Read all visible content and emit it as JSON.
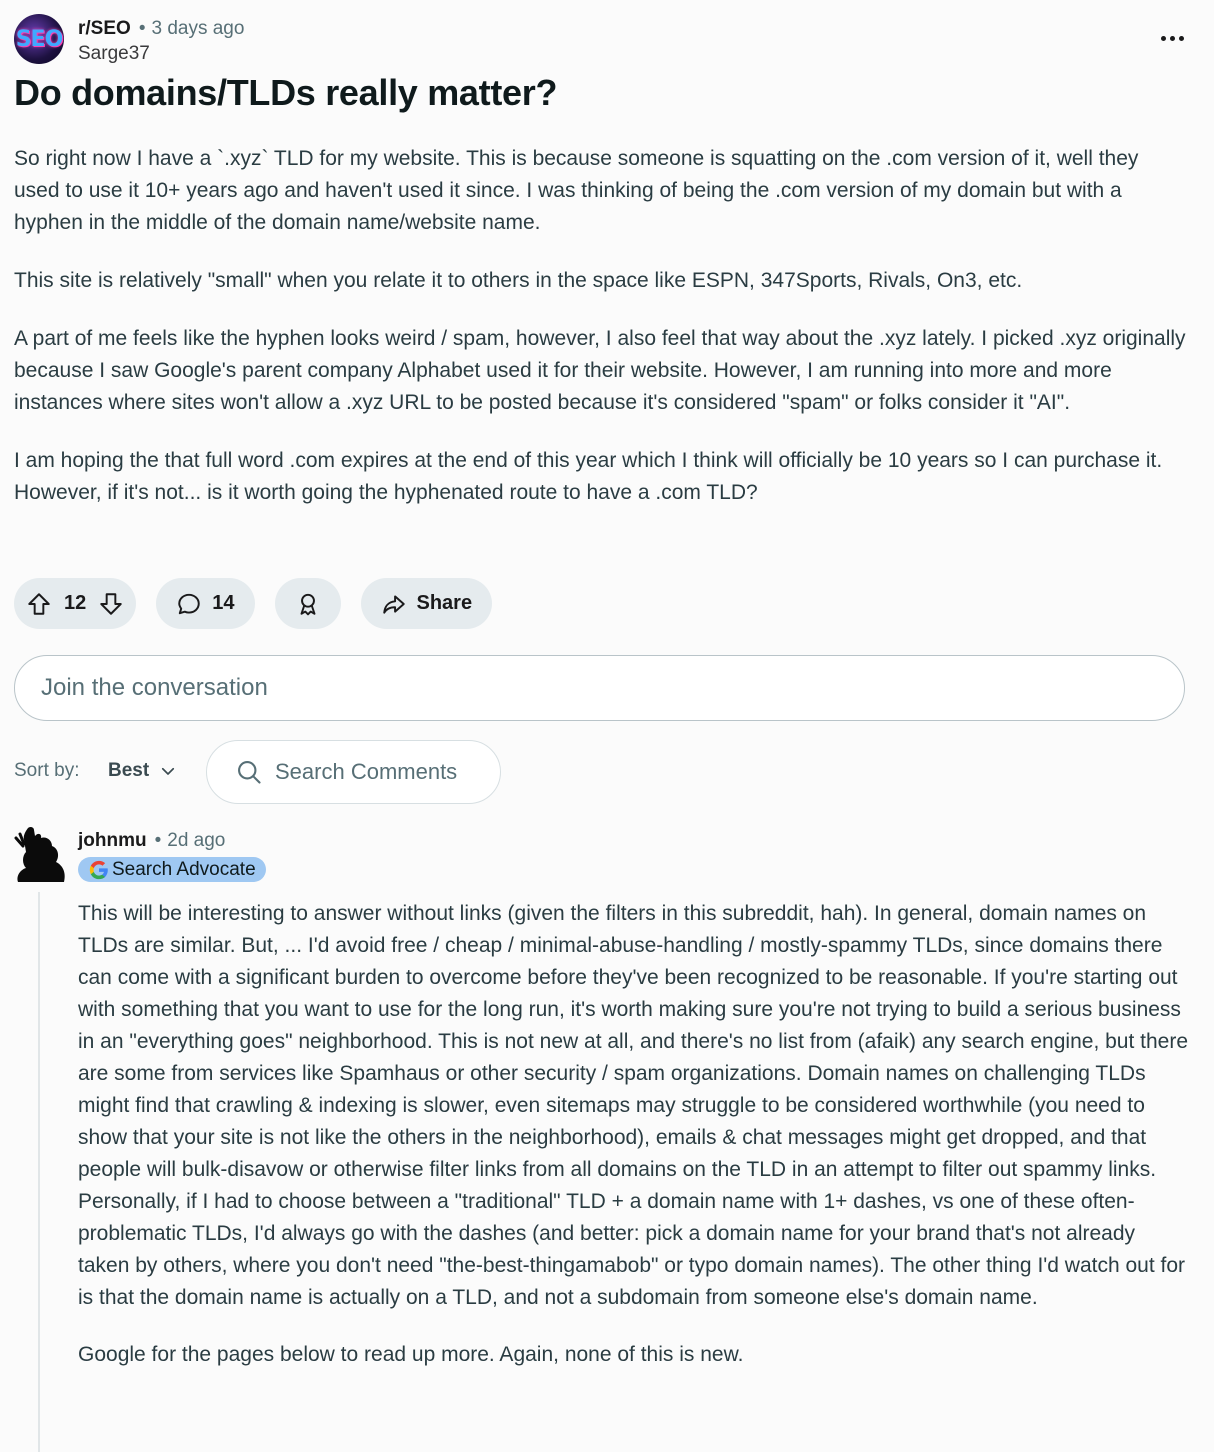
{
  "post": {
    "subreddit": "r/SEO",
    "subreddit_icon_text": "SEO",
    "time": "3 days ago",
    "author": "Sarge37",
    "title": "Do domains/TLDs really matter?",
    "paragraphs": [
      "So right now I have a `.xyz` TLD for my website. This is because someone is squatting on the .com version of it, well they used to use it 10+ years ago and haven't used it since. I was thinking of being the .com version of my domain but with a hyphen in the middle of the domain name/website name.",
      "This site is relatively \"small\" when you relate it to others in the space like ESPN, 347Sports, Rivals, On3, etc.",
      "A part of me feels like the hyphen looks weird / spam, however, I also feel that way about the .xyz lately. I picked .xyz originally because I saw Google's parent company Alphabet used it for their website. However, I am running into more and more instances where sites won't allow a .xyz URL to be posted because it's considered \"spam\" or folks consider it \"AI\".",
      "I am hoping the that full word .com expires at the end of this year which I think will officially be 10 years so I can purchase it. However, if it's not... is it worth going the hyphenated route to have a .com TLD?"
    ],
    "votes": "12",
    "comments": "14",
    "share_label": "Share"
  },
  "join_placeholder": "Join the conversation",
  "sort": {
    "label": "Sort by:",
    "value": "Best"
  },
  "search_placeholder": "Search Comments",
  "comment": {
    "author": "johnmu",
    "time": "2d ago",
    "flair": "Search Advocate",
    "paragraphs": [
      "This will be interesting to answer without links (given the filters in this subreddit, hah). In general, domain names on TLDs are similar. But, ... I'd avoid free / cheap / minimal-abuse-handling / mostly-spammy TLDs, since domains there can come with a significant burden to overcome before they've been recognized to be reasonable. If you're starting out with something that you want to use for the long run, it's worth making sure you're not trying to build a serious business in an \"everything goes\" neighborhood. This is not new at all, and there's no list from (afaik) any search engine, but there are some from services like Spamhaus or other security / spam organizations. Domain names on challenging TLDs might find that crawling & indexing is slower, even sitemaps may struggle to be considered worthwhile (you need to show that your site is not like the others in the neighborhood), emails & chat messages might get dropped, and that people will bulk-disavow or otherwise filter links from all domains on the TLD in an attempt to filter out spammy links. Personally, if I had to choose between a \"traditional\" TLD + a domain name with 1+ dashes, vs one of these often-problematic TLDs, I'd always go with the dashes (and better: pick a domain name for your brand that's not already taken by others, where you don't need \"the-best-thingamabob\" or typo domain names). The other thing I'd watch out for is that the domain name is actually on a TLD, and not a subdomain from someone else's domain name.",
      "Google for the pages below to read up more. Again, none of this is new."
    ]
  }
}
